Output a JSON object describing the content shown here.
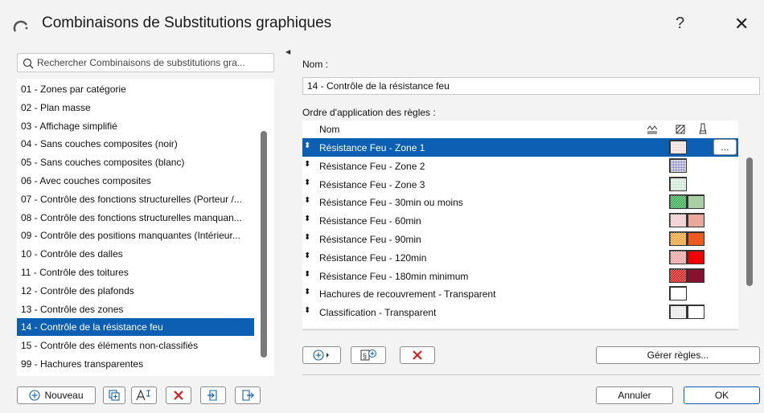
{
  "window": {
    "title": "Combinaisons de Substitutions graphiques",
    "help_label": "?",
    "close_label": "✕"
  },
  "search": {
    "placeholder": "Rechercher Combinaisons de substitutions gra..."
  },
  "combinations": [
    "01 - Zones par catégorie",
    "02 - Plan masse",
    "03 - Affichage simplifié",
    "04 - Sans couches composites (noir)",
    "05 - Sans couches composites (blanc)",
    "06 - Avec couches composites",
    "07 - Contrôle des fonctions structurelles (Porteur /...",
    "08 - Contrôle des fonctions structurelles manquan...",
    "09 - Contrôle des positions manquantes (Intérieur...",
    "10 - Contrôle des dalles",
    "11 - Contrôle des toitures",
    "12 - Contrôle des plafonds",
    "13 - Contrôle des zones",
    "14 - Contrôle de la résistance feu",
    "15 - Contrôle des éléments non-classifiés",
    "99 - Hachures transparentes"
  ],
  "selected_index": 13,
  "left_buttons": {
    "new_label": "Nouveau"
  },
  "form": {
    "name_label": "Nom :",
    "name_value": "14 - Contrôle de la résistance feu",
    "order_label": "Ordre d'application des règles :"
  },
  "rules_table": {
    "header_name": "Nom",
    "more_label": "...",
    "rows": [
      {
        "label": "Résistance Feu - Zone 1",
        "fg": "#f2b8b8",
        "fg_pattern": "dots",
        "bg": null,
        "selected": true
      },
      {
        "label": "Résistance Feu - Zone 2",
        "fg": "#3a3ad0",
        "fg_pattern": "dots",
        "bg": null
      },
      {
        "label": "Résistance Feu - Zone 3",
        "fg": "#9dd8a8",
        "fg_pattern": "dots",
        "bg": null
      },
      {
        "label": "Résistance Feu - 30min ou moins",
        "fg": "#2ea84a",
        "fg_pattern": "hatch",
        "bg": "#a9cfa4"
      },
      {
        "label": "Résistance Feu - 60min",
        "fg": "#eecaca",
        "fg_pattern": "hatch",
        "bg": "#e8a99a"
      },
      {
        "label": "Résistance Feu - 90min",
        "fg": "#f5a030",
        "fg_pattern": "hatch",
        "bg": "#ec5a20"
      },
      {
        "label": "Résistance Feu - 120min",
        "fg": "#f0a0a0",
        "fg_pattern": "hatch",
        "bg": "#f20000"
      },
      {
        "label": "Résistance Feu - 180min minimum",
        "fg": "#e01010",
        "fg_pattern": "hatch",
        "bg": "#8a1030"
      },
      {
        "label": "Hachures de recouvrement - Transparent",
        "fg": "#ffffff",
        "fg_pattern": "none",
        "bg": null
      },
      {
        "label": "Classification - Transparent",
        "fg": "#d0d0d0",
        "fg_pattern": "dots",
        "bg": "#ffffff"
      }
    ]
  },
  "bottom": {
    "manage_rules_label": "Gérer règles...",
    "cancel_label": "Annuler",
    "ok_label": "OK"
  },
  "colors": {
    "selection": "#0c5fb3",
    "delete_red": "#d42020",
    "ok_border": "#0c5fb3"
  },
  "icons": [
    "window-logo-icon",
    "search-icon",
    "add-icon",
    "duplicate-icon",
    "rename-icon",
    "delete-icon",
    "import-icon",
    "export-icon",
    "fill-header-icon",
    "pen-header-icon",
    "cut-fill-header-icon",
    "drag-handle-icon"
  ]
}
